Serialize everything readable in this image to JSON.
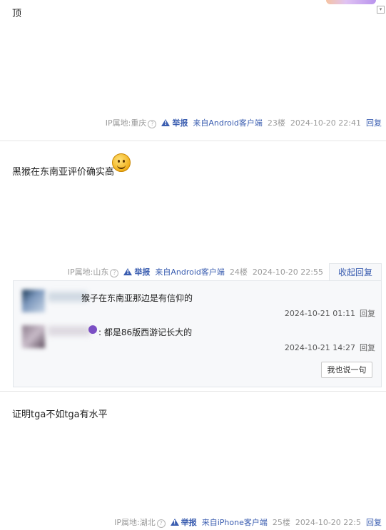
{
  "post1": {
    "text": "顶",
    "ip": "IP属地:重庆",
    "report": "举报",
    "client": "来自Android客户端",
    "floor": "23楼",
    "time": "2024-10-20 22:41",
    "reply": "回复"
  },
  "post2": {
    "text": "黑猴在东南亚评价确实高",
    "ip": "IP属地:山东",
    "report": "举报",
    "client": "来自Android客户端",
    "floor": "24楼",
    "time": "2024-10-20 22:55",
    "collapse": "收起回复",
    "replies": [
      {
        "text": "猴子在东南亚那边是有信仰的",
        "time": "2024-10-21 01:11",
        "reply": "回复"
      },
      {
        "text": ": 都是86版西游记长大的",
        "time": "2024-10-21 14:27",
        "reply": "回复"
      }
    ],
    "say_button": "我也说一句"
  },
  "post3": {
    "text": "证明tga不如tga有水平",
    "ip": "IP属地:湖北",
    "report": "举报",
    "client": "来自iPhone客户端",
    "floor": "25楼",
    "time": "2024-10-20 22:5",
    "reply": "回复"
  },
  "colors": {
    "link": "#3a5db0",
    "meta": "#9a9a9a",
    "reply_bg": "#f7f8fa"
  }
}
